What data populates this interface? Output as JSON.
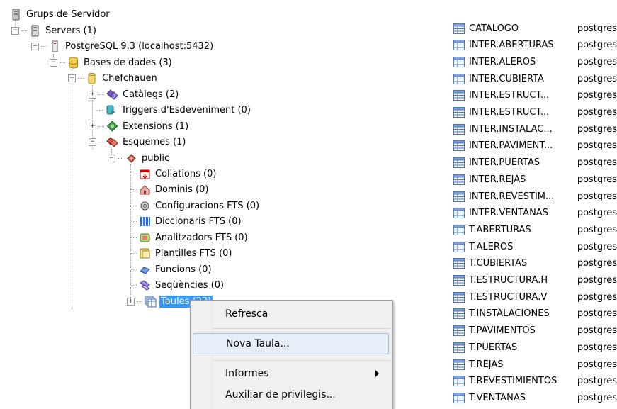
{
  "tree": {
    "server_groups": "Grups de Servidor",
    "servers": "Servers (1)",
    "postgres": "PostgreSQL 9.3 (localhost:5432)",
    "databases": "Bases de dades (3)",
    "chefchauen": "Chefchauen",
    "catalegs": "Catàlegs (2)",
    "event_triggers": "Triggers d'Esdeveniment (0)",
    "extensions": "Extensions (1)",
    "esquemes": "Esquemes (1)",
    "public": "public",
    "collations": "Collations (0)",
    "dominis": "Dominis (0)",
    "fts_config": "Configuracions FTS (0)",
    "fts_dict": "Diccionaris FTS (0)",
    "fts_parser": "Analitzadors FTS (0)",
    "fts_templates": "Plantilles FTS (0)",
    "funcions": "Funcions (0)",
    "sequencies": "Seqüències (0)",
    "taules": "Taules (22)"
  },
  "tables": [
    {
      "name": "CATALOGO",
      "owner": "postgres"
    },
    {
      "name": "INTER.ABERTURAS",
      "owner": "postgres"
    },
    {
      "name": "INTER.ALEROS",
      "owner": "postgres"
    },
    {
      "name": "INTER.CUBIERTA",
      "owner": "postgres"
    },
    {
      "name": "INTER.ESTRUCT...",
      "owner": "postgres"
    },
    {
      "name": "INTER.ESTRUCT...",
      "owner": "postgres"
    },
    {
      "name": "INTER.INSTALAC...",
      "owner": "postgres"
    },
    {
      "name": "INTER.PAVIMENT...",
      "owner": "postgres"
    },
    {
      "name": "INTER.PUERTAS",
      "owner": "postgres"
    },
    {
      "name": "INTER.REJAS",
      "owner": "postgres"
    },
    {
      "name": "INTER.REVESTIM...",
      "owner": "postgres"
    },
    {
      "name": "INTER.VENTANAS",
      "owner": "postgres"
    },
    {
      "name": "T.ABERTURAS",
      "owner": "postgres"
    },
    {
      "name": "T.ALEROS",
      "owner": "postgres"
    },
    {
      "name": "T.CUBIERTAS",
      "owner": "postgres"
    },
    {
      "name": "T.ESTRUCTURA.H",
      "owner": "postgres"
    },
    {
      "name": "T.ESTRUCTURA.V",
      "owner": "postgres"
    },
    {
      "name": "T.INSTALACIONES",
      "owner": "postgres"
    },
    {
      "name": "T.PAVIMENTOS",
      "owner": "postgres"
    },
    {
      "name": "T.PUERTAS",
      "owner": "postgres"
    },
    {
      "name": "T.REJAS",
      "owner": "postgres"
    },
    {
      "name": "T.REVESTIMIENTOS",
      "owner": "postgres"
    },
    {
      "name": "T.VENTANAS",
      "owner": "postgres"
    }
  ],
  "context_menu": {
    "refresh": "Refresca",
    "new_table": "Nova Taula...",
    "reports": "Informes",
    "privileges": "Auxiliar de privilegis..."
  },
  "colors": {
    "selection": "#3399ff",
    "menu_bg": "#f0f0f0",
    "menu_hover": "#e8eef7"
  }
}
